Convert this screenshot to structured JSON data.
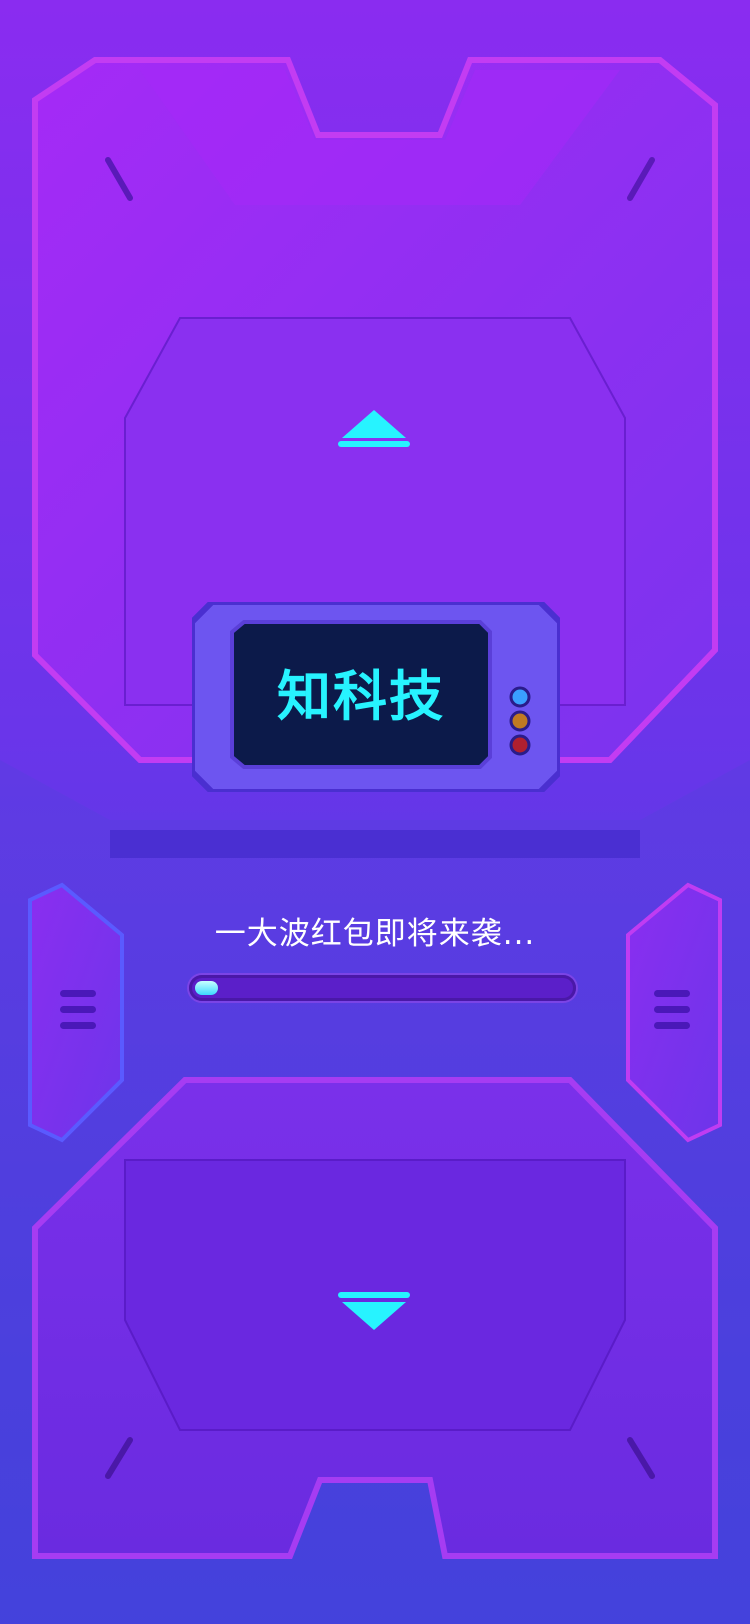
{
  "logo": {
    "text": "知科技"
  },
  "loading": {
    "text": "一大波红包即将来袭...",
    "progress": 0.06
  },
  "colors": {
    "accent_cyan": "#27f3ff",
    "panel_purple": "#9a2ff4",
    "indicator_blue": "#3aa0ff",
    "indicator_orange": "#c07a22",
    "indicator_red": "#b02030"
  },
  "icons": {
    "up": "triangle-up-icon",
    "down": "triangle-down-icon",
    "menu": "three-lines-icon"
  }
}
